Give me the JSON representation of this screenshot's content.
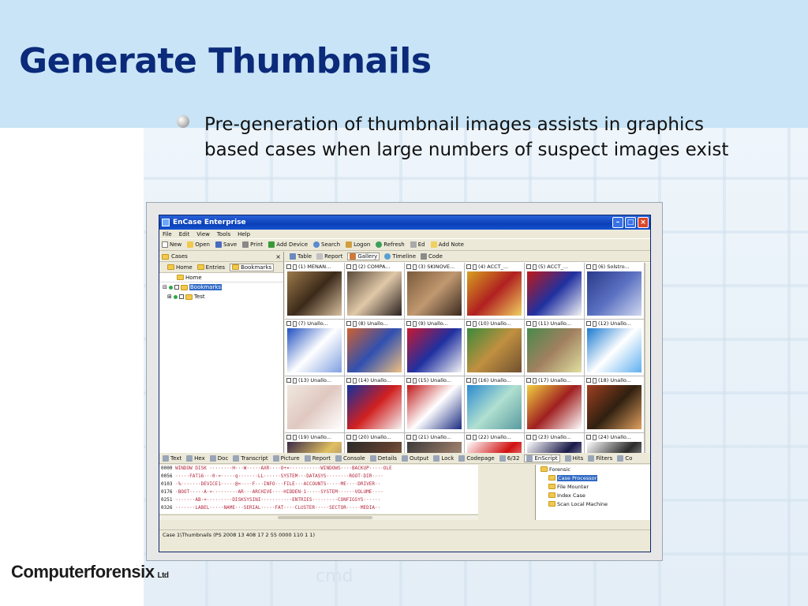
{
  "slide": {
    "title": "Generate Thumbnails",
    "bullet_line1": "Pre-generation of thumbnail images assists in graphics",
    "bullet_line2": "based cases when large numbers of suspect images exist",
    "logo_text": "Computerforensix",
    "logo_suffix": "Ltd",
    "watermark": "cmd"
  },
  "app": {
    "window_title": "EnCase Enterprise",
    "menu": [
      "File",
      "Edit",
      "View",
      "Tools",
      "Help"
    ],
    "toolbar": [
      "New",
      "Open",
      "Save",
      "Print",
      "Add Device",
      "Search",
      "Logon",
      "Refresh",
      "Ed",
      "Add Note"
    ],
    "cases_pane": {
      "title": "Cases",
      "close": "×",
      "tabs": [
        "Home",
        "Entries",
        "Bookmarks"
      ],
      "home_label": "Home",
      "tree": [
        {
          "label": "Bookmarks",
          "selected": true
        },
        {
          "label": "Test",
          "selected": false
        }
      ]
    },
    "gallery_tabs": [
      "Table",
      "Report",
      "Gallery",
      "Timeline",
      "Code"
    ],
    "thumbnails": [
      {
        "label": "(1) MENAN...",
        "colors": [
          "#9c7a4a",
          "#3c2a1a",
          "#d8c0a0"
        ]
      },
      {
        "label": "(2) COMPA...",
        "colors": [
          "#5a4a3a",
          "#e0c8a8",
          "#2a2020"
        ]
      },
      {
        "label": "(3) SKINOVE...",
        "colors": [
          "#7a5a3a",
          "#c09870",
          "#3a2a20"
        ]
      },
      {
        "label": "(4) ACCT_...",
        "colors": [
          "#d6a020",
          "#b02020",
          "#f0d060"
        ]
      },
      {
        "label": "(5) ACCT_...",
        "colors": [
          "#c01818",
          "#2030a0",
          "#f4f4f4"
        ]
      },
      {
        "label": "(6) Solstro...",
        "colors": [
          "#2a3a8a",
          "#5a70c0",
          "#d0d8f0"
        ]
      },
      {
        "label": "(7) Unallo...",
        "colors": [
          "#2050c0",
          "#ffffff",
          "#80a0e0"
        ]
      },
      {
        "label": "(8) Unallo...",
        "colors": [
          "#d06030",
          "#3050b0",
          "#f0c080"
        ]
      },
      {
        "label": "(9) Unallo...",
        "colors": [
          "#c81830",
          "#2030a0",
          "#f4f4f4"
        ]
      },
      {
        "label": "(10) Unallo...",
        "colors": [
          "#3a8a3a",
          "#c09040",
          "#705030"
        ]
      },
      {
        "label": "(11) Unallo...",
        "colors": [
          "#4a8a4a",
          "#a08060",
          "#e0e0a0"
        ]
      },
      {
        "label": "(12) Unallo...",
        "colors": [
          "#1a7ad0",
          "#ffffff",
          "#60b0f0"
        ]
      },
      {
        "label": "(13) Unallo...",
        "colors": [
          "#f0e8e0",
          "#e0c8c0",
          "#ffffff"
        ]
      },
      {
        "label": "(14) Unallo...",
        "colors": [
          "#1030a0",
          "#d02020",
          "#f4f4f4"
        ]
      },
      {
        "label": "(15) Unallo...",
        "colors": [
          "#c01818",
          "#ffffff",
          "#1a2a80"
        ]
      },
      {
        "label": "(16) Unallo...",
        "colors": [
          "#2a8ad0",
          "#b0e0d0",
          "#5a9aa0"
        ]
      },
      {
        "label": "(17) Unallo...",
        "colors": [
          "#f0d040",
          "#a02020",
          "#ffffff"
        ]
      },
      {
        "label": "(18) Unallo...",
        "colors": [
          "#a04020",
          "#302010",
          "#e0a060"
        ]
      },
      {
        "label": "(19) Unallo...",
        "colors": [
          "#3a2a4a",
          "#e0c060",
          "#806080"
        ]
      },
      {
        "label": "(20) Unallo...",
        "colors": [
          "#2a2a2a",
          "#604030",
          "#a08060"
        ]
      },
      {
        "label": "(21) Unallo...",
        "colors": [
          "#3a3a3a",
          "#8a7060",
          "#c0b0a0"
        ]
      },
      {
        "label": "(22) Unallo...",
        "colors": [
          "#ffffff",
          "#d01010",
          "#ffffff"
        ]
      },
      {
        "label": "(23) Unallo...",
        "colors": [
          "#ffffff",
          "#1a1a4a",
          "#ffffff"
        ]
      },
      {
        "label": "(24) Unallo...",
        "colors": [
          "#ffffff",
          "#2a2a2a",
          "#ffffff"
        ]
      }
    ],
    "bottom_tabs": [
      "Text",
      "Hex",
      "Doc",
      "Transcript",
      "Picture",
      "Report",
      "Console",
      "Details",
      "Output",
      "Lock",
      "Codepage",
      "6/32",
      "EnScript",
      "Hits",
      "Filters",
      "Co"
    ],
    "hex_lines": [
      {
        "offset": "0000",
        "text": "WINDOW DISK ········H···W·····AXR····O+¤···········WINDOWS····BACKUP·····OLE"
      },
      {
        "offset": "0056",
        "text": "·····FAT16···0·¤·····q·······LL······SYSTEM···DATASYS········ROOT·DIR····"
      },
      {
        "offset": "0103",
        "text": "·%·······DEVICE1·····@¤····F···INFO···FILE···ACCOUNTS·····ME····DRIVER··"
      },
      {
        "offset": "0176",
        "text": "·BOOT·····A·¤·········AR···ARCHIVE····HIDDEN·1·····SYSTEM······VOLUME····"
      },
      {
        "offset": "0251",
        "text": "·······AB·¤·········DISKSYSINI···········ENTRIES·········CONFIGSYS······"
      },
      {
        "offset": "0326",
        "text": "·······LABEL·····NAME···SERIAL·····FAT····CLUSTER·····SECTOR·····MEDIA··"
      }
    ],
    "tree_pane": [
      "Forensic",
      "Case Processor",
      "File Mounter",
      "Index Case",
      "Scan Local Machine"
    ],
    "status_text": "Case 1\\Thumbnails (PS 2008 13 408 17 2 55 0000 110 1 1)"
  }
}
